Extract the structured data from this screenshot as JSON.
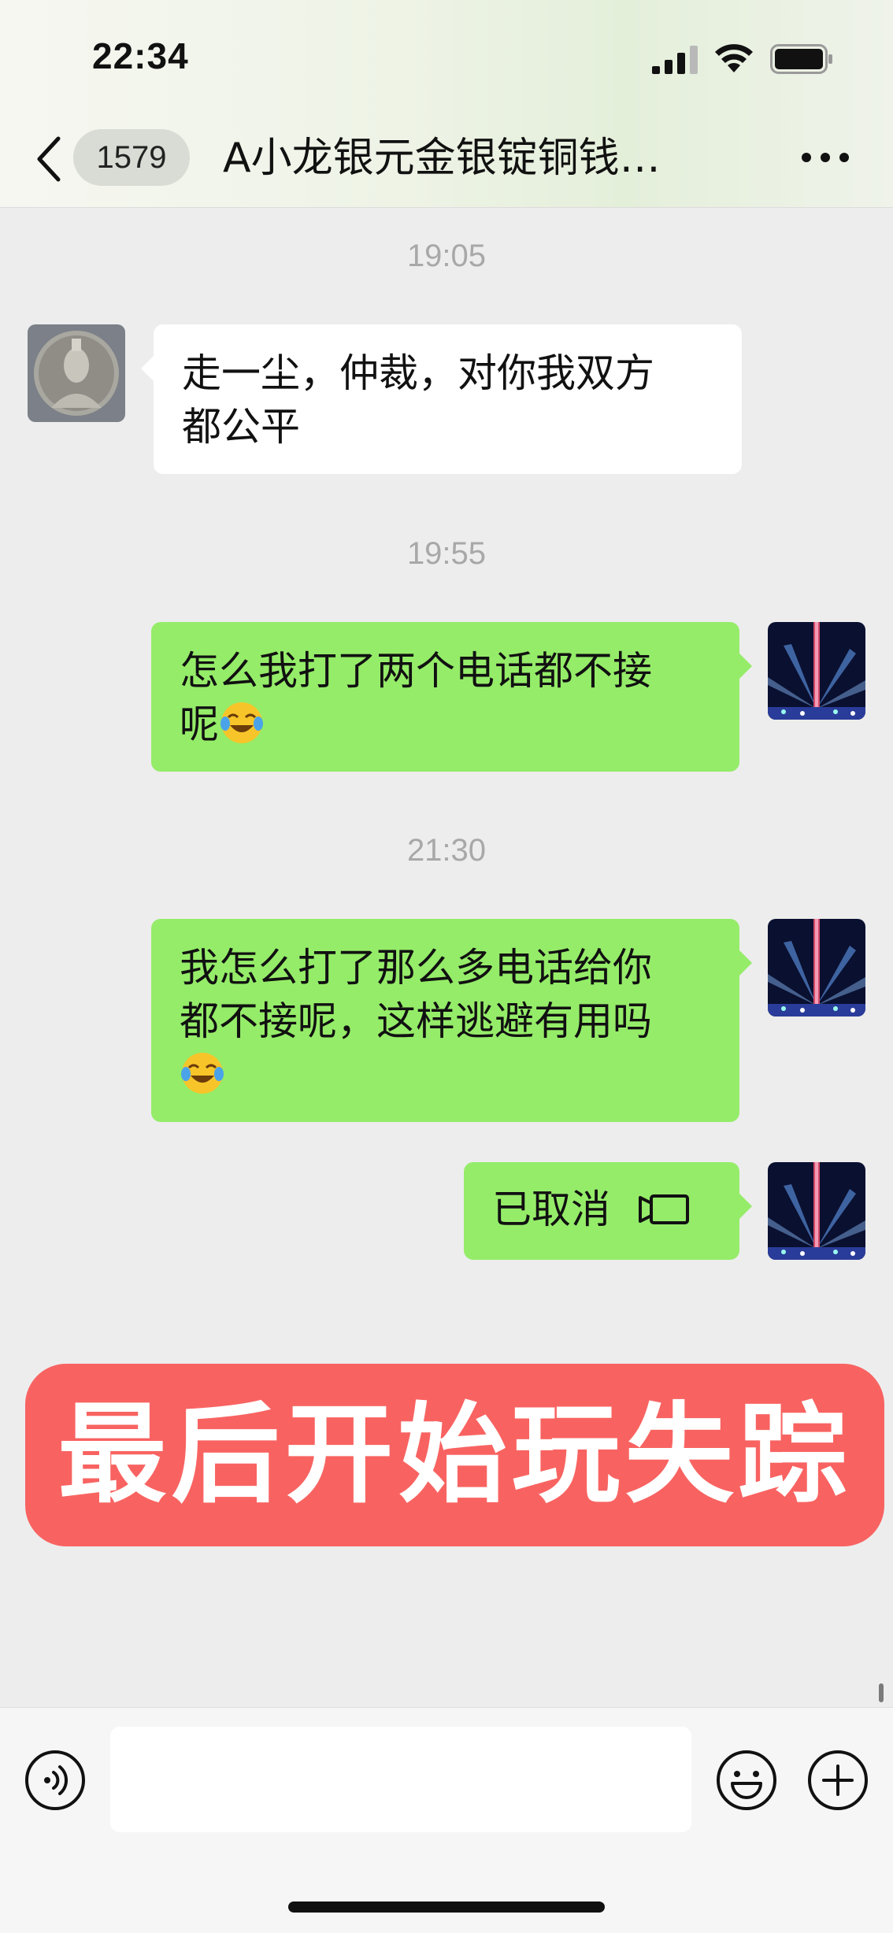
{
  "status_bar": {
    "time": "22:34",
    "icons": [
      "signal-icon",
      "wifi-icon",
      "battery-icon"
    ]
  },
  "nav": {
    "back_icon": "chevron-left-icon",
    "unread_count": "1579",
    "title": "A小龙银元金银锭铜钱…",
    "more_icon": "ellipsis-icon"
  },
  "messages": [
    {
      "type": "timestamp",
      "text": "19:05"
    },
    {
      "type": "text",
      "side": "left",
      "lines": [
        "走一尘，仲裁，对你我双方",
        "都公平"
      ]
    },
    {
      "type": "timestamp",
      "text": "19:55"
    },
    {
      "type": "text",
      "side": "right",
      "lines": [
        "怎么我打了两个电话都不接",
        "呢"
      ],
      "emoji": "face-with-tears-of-joy"
    },
    {
      "type": "timestamp",
      "text": "21:30"
    },
    {
      "type": "text",
      "side": "right",
      "lines": [
        "我怎么打了那么多电话给你",
        "都不接呢，这样逃避有用吗",
        ""
      ],
      "emoji": "face-with-tears-of-joy"
    },
    {
      "type": "call",
      "side": "right",
      "text": "已取消",
      "icon": "video-call-icon"
    }
  ],
  "banner": {
    "text": "最后开始玩失踪",
    "color": "#f86361"
  },
  "input_bar": {
    "voice_icon": "voice-icon",
    "input_value": "",
    "emoji_icon": "smiley-icon",
    "plus_icon": "plus-circle-icon"
  },
  "colors": {
    "chat_background": "#ededed",
    "sent_bubble": "#95ec69",
    "received_bubble": "#ffffff"
  }
}
